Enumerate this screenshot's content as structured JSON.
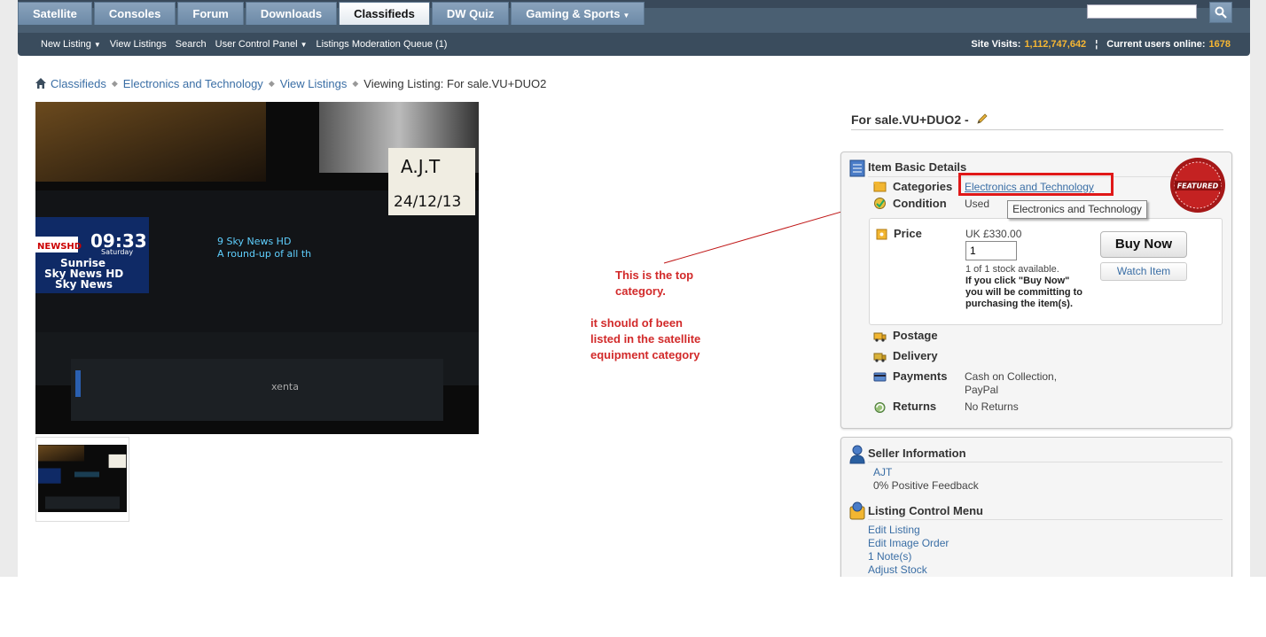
{
  "nav": {
    "tabs": [
      {
        "label": "Satellite",
        "caret": false
      },
      {
        "label": "Consoles",
        "caret": false
      },
      {
        "label": "Forum",
        "caret": false
      },
      {
        "label": "Downloads",
        "caret": false
      },
      {
        "label": "Classifieds",
        "caret": false,
        "active": true
      },
      {
        "label": "DW Quiz",
        "caret": false
      },
      {
        "label": "Gaming & Sports",
        "caret": true
      }
    ],
    "search_placeholder": ""
  },
  "subnav": {
    "links": [
      {
        "label": "New Listing",
        "caret": true
      },
      {
        "label": "View Listings",
        "caret": false
      },
      {
        "label": "Search",
        "caret": false
      },
      {
        "label": "User Control Panel",
        "caret": true
      },
      {
        "label": "Listings Moderation Queue (1)",
        "caret": false
      }
    ],
    "site_visits_label": "Site Visits:",
    "site_visits_value": "1,112,747,642",
    "separator": "¦",
    "users_online_label": "Current users online:",
    "users_online_value": "1678"
  },
  "breadcrumb": {
    "items": [
      "Classifieds",
      "Electronics and Technology",
      "View Listings"
    ],
    "current": "Viewing Listing: For sale.VU+DUO2"
  },
  "listing": {
    "title": "For sale.VU+DUO2 -"
  },
  "details": {
    "title": "Item Basic Details",
    "categories_label": "Categories",
    "categories_value": "Electronics and Technology",
    "condition_label": "Condition",
    "condition_value": "Used",
    "price_label": "Price",
    "price_value": "UK £330.00",
    "quantity_value": "1",
    "stock_text": "1 of 1 stock available.",
    "commit_note": "If you click \"Buy Now\" you will be committing to purchasing the item(s).",
    "buy_now_label": "Buy Now",
    "watch_item_label": "Watch Item",
    "postage_label": "Postage",
    "delivery_label": "Delivery",
    "payments_label": "Payments",
    "payments_value": "Cash on Collection, PayPal",
    "returns_label": "Returns",
    "returns_value": "No Returns",
    "featured_label": "FEATURED",
    "tooltip": "Electronics and Technology"
  },
  "seller": {
    "title": "Seller Information",
    "name": "AJT",
    "feedback": "0% Positive Feedback"
  },
  "control_menu": {
    "title": "Listing Control Menu",
    "items": [
      "Edit Listing",
      "Edit Image Order",
      "1 Note(s)",
      "Adjust Stock"
    ]
  },
  "annotation": {
    "line1": "This is the top",
    "line2": "category.",
    "line3": "it should of been",
    "line4": "listed in the satellite",
    "line5": "equipment category"
  },
  "photo": {
    "label_line1": "A.J.T",
    "label_line2": "24/12/13",
    "clock": "09:33",
    "day": "Saturday",
    "channel_badge": "NEWSHD",
    "left_lines": [
      "Sunrise",
      "Sky News HD",
      "Sky News"
    ],
    "vfd_text": "9  Sky News HD",
    "vfd_text2": "A round-up of all th",
    "brand": "xenta"
  },
  "colors": {
    "nav_bg": "#4a5f72",
    "subnav_bg": "#3a4c5d",
    "link": "#3a6ea5",
    "accent_orange": "#f7b733",
    "annotation_red": "#d22a2a",
    "highlight_red": "#e01818"
  }
}
